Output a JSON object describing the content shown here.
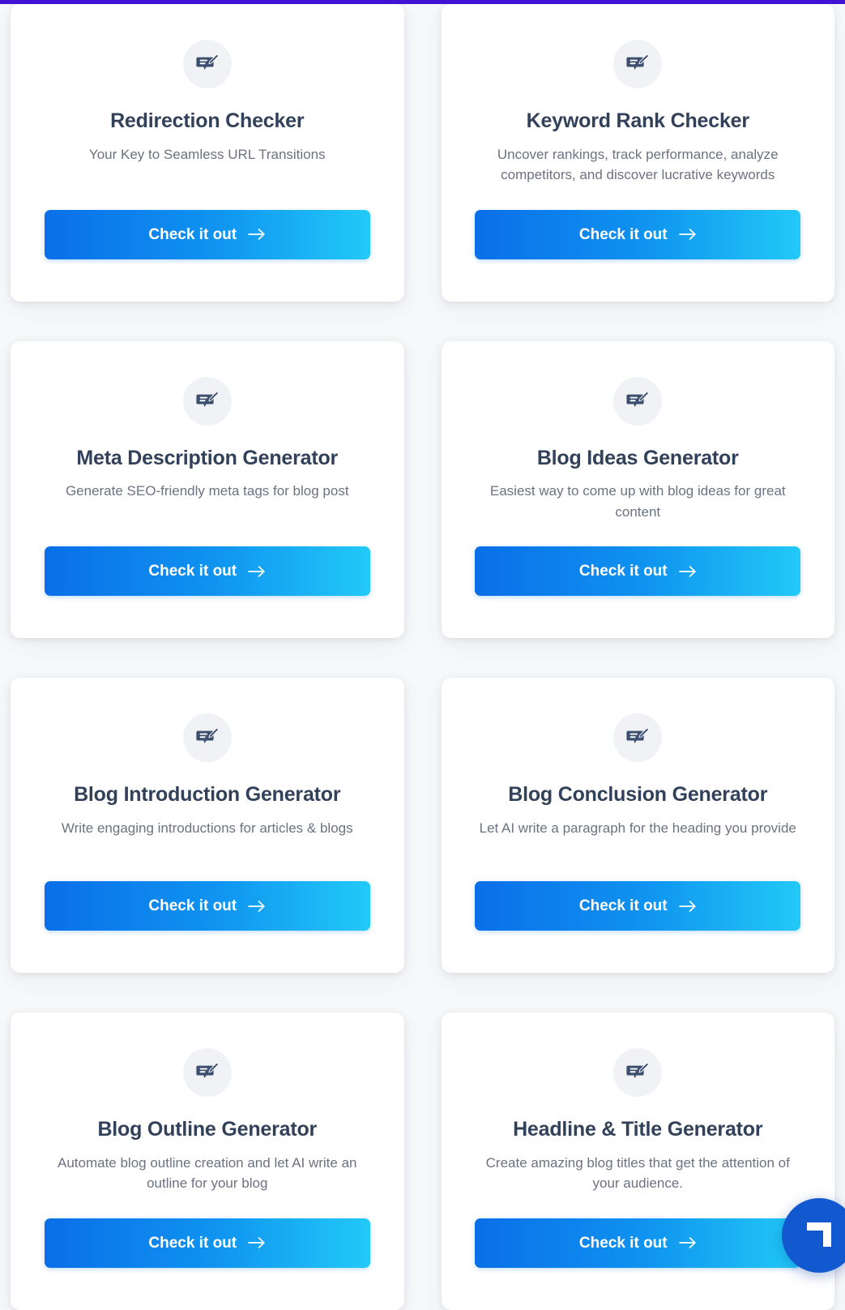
{
  "progress_bar": {
    "color": "#4012d4",
    "visible": true
  },
  "theme": {
    "page_background": "#f7f8fa",
    "card_background": "#ffffff",
    "title_color": "#32415a",
    "description_color": "#6b7280",
    "icon_circle_background": "#f1f2f6",
    "icon_color": "#3c4f6e",
    "button_gradient_start": "#0a6fe8",
    "button_gradient_end": "#22c9f6",
    "button_text_color": "#ffffff",
    "fab_color": "#1259cf"
  },
  "fab": {
    "icon": "corner-arrow-logo-icon",
    "label": ""
  },
  "cards": [
    {
      "icon": "comment-edit-icon",
      "title": "Redirection Checker",
      "description": "Your Key to Seamless URL Transitions",
      "cta_label": "Check it out",
      "cta_icon": "arrow-right-icon"
    },
    {
      "icon": "comment-edit-icon",
      "title": "Keyword Rank Checker",
      "description": "Uncover rankings, track performance, analyze competitors, and discover lucrative keywords",
      "cta_label": "Check it out",
      "cta_icon": "arrow-right-icon"
    },
    {
      "icon": "comment-edit-icon",
      "title": "Meta Description Generator",
      "description": "Generate SEO-friendly meta tags for blog post",
      "cta_label": "Check it out",
      "cta_icon": "arrow-right-icon"
    },
    {
      "icon": "comment-edit-icon",
      "title": "Blog Ideas Generator",
      "description": "Easiest way to come up with blog ideas for great content",
      "cta_label": "Check it out",
      "cta_icon": "arrow-right-icon"
    },
    {
      "icon": "comment-edit-icon",
      "title": "Blog Introduction Generator",
      "description": "Write engaging introductions for articles & blogs",
      "cta_label": "Check it out",
      "cta_icon": "arrow-right-icon"
    },
    {
      "icon": "comment-edit-icon",
      "title": "Blog Conclusion Generator",
      "description": "Let AI write a paragraph for the heading you provide",
      "cta_label": "Check it out",
      "cta_icon": "arrow-right-icon"
    },
    {
      "icon": "comment-edit-icon",
      "title": "Blog Outline Generator",
      "description": "Automate blog outline creation and let AI write an outline for your blog",
      "cta_label": "Check it out",
      "cta_icon": "arrow-right-icon"
    },
    {
      "icon": "comment-edit-icon",
      "title": "Headline & Title Generator",
      "description": "Create amazing blog titles that get the attention of your audience.",
      "cta_label": "Check it out",
      "cta_icon": "arrow-right-icon"
    }
  ]
}
